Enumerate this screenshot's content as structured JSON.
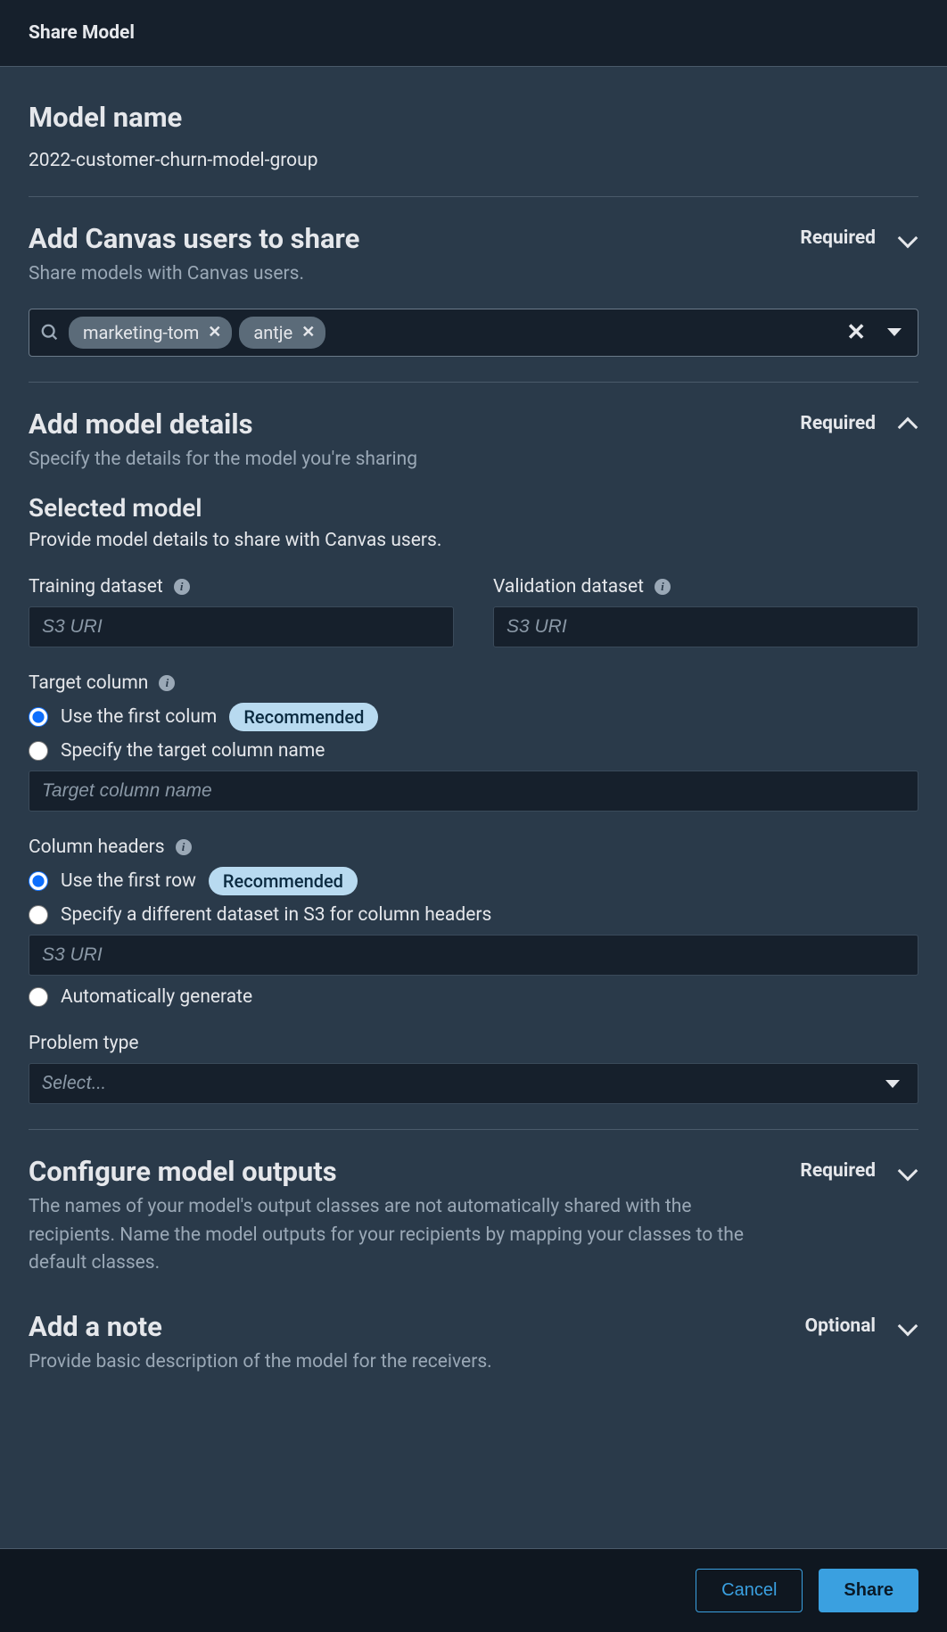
{
  "header": {
    "title": "Share Model"
  },
  "model_name_section": {
    "title": "Model name",
    "value": "2022-customer-churn-model-group"
  },
  "canvas_users": {
    "title": "Add Canvas users to share",
    "required_label": "Required",
    "subtitle": "Share models with Canvas users.",
    "tags": [
      "marketing-tom",
      "antje"
    ]
  },
  "model_details": {
    "title": "Add model details",
    "required_label": "Required",
    "subtitle": "Specify the details for the model you're sharing",
    "selected_model_title": "Selected model",
    "selected_model_sub": "Provide model details to share with Canvas users.",
    "training_label": "Training dataset",
    "training_placeholder": "S3 URI",
    "validation_label": "Validation dataset",
    "validation_placeholder": "S3 URI",
    "target_label": "Target column",
    "target_opt1": "Use the first colum",
    "target_opt2": "Specify the target column name",
    "target_input_placeholder": "Target column name",
    "recommended": "Recommended",
    "headers_label": "Column headers",
    "headers_opt1": "Use the first row",
    "headers_opt2": "Specify a different dataset in S3 for column headers",
    "headers_input_placeholder": "S3 URI",
    "headers_opt3": "Automatically generate",
    "problem_label": "Problem type",
    "problem_placeholder": "Select..."
  },
  "outputs": {
    "title": "Configure model outputs",
    "required_label": "Required",
    "subtitle": "The names of your model's output classes are not automatically shared with the recipients. Name the model outputs for your recipients by mapping your classes to the default classes."
  },
  "note": {
    "title": "Add a note",
    "optional_label": "Optional",
    "subtitle": "Provide basic description of the model for the receivers."
  },
  "footer": {
    "cancel": "Cancel",
    "share": "Share"
  }
}
